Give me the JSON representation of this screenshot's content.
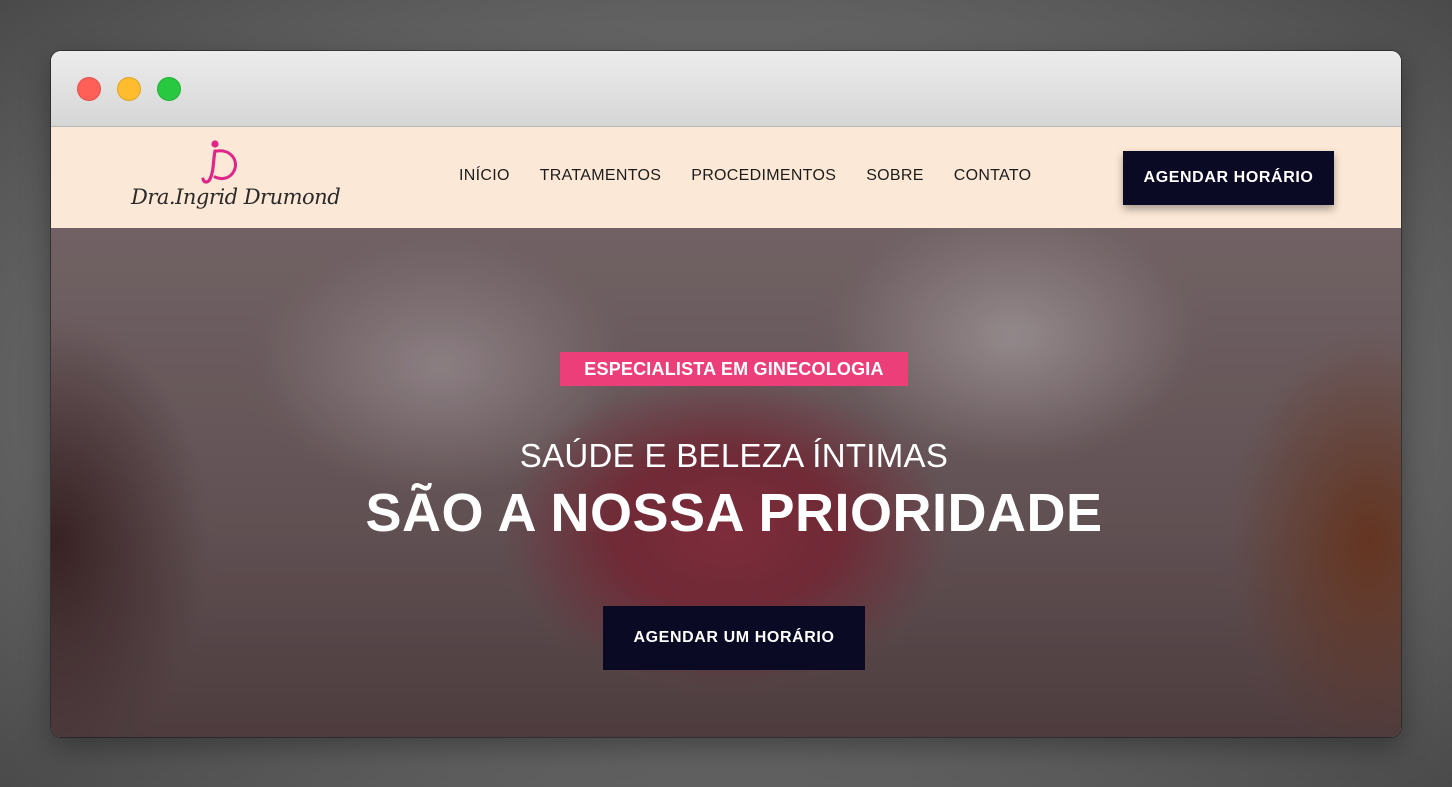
{
  "logo": {
    "text": "Dra.Ingrid Drumond",
    "mark_color": "#e0258a"
  },
  "nav": {
    "items": [
      {
        "label": "INÍCIO"
      },
      {
        "label": "TRATAMENTOS"
      },
      {
        "label": "PROCEDIMENTOS"
      },
      {
        "label": "SOBRE"
      },
      {
        "label": "CONTATO"
      }
    ],
    "cta_label": "AGENDAR HORÁRIO"
  },
  "hero": {
    "badge": "ESPECIALISTA EM GINECOLOGIA",
    "subtitle": "SAÚDE E BELEZA ÍNTIMAS",
    "title": "SÃO A NOSSA PRIORIDADE",
    "cta_label": "AGENDAR UM HORÁRIO"
  },
  "colors": {
    "navbar_bg": "#fce8d6",
    "button_bg": "#0b0a24",
    "badge_bg": "#ec3f79"
  }
}
